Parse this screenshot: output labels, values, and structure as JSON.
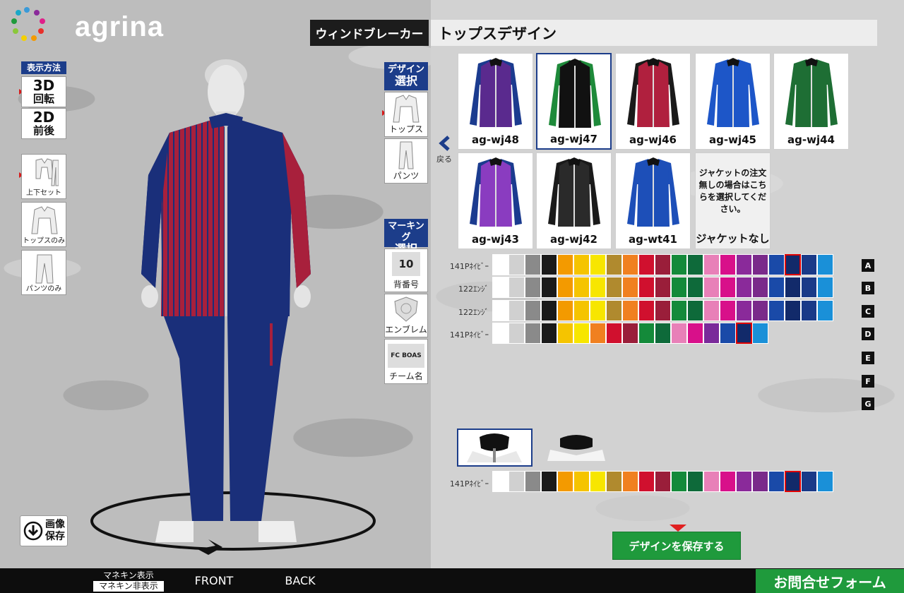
{
  "brand": {
    "name": "agrina"
  },
  "header": {
    "category": "ウィンドブレーカー",
    "title": "トップスデザイン"
  },
  "display_method": {
    "label": "表示方法",
    "options": [
      {
        "main": "3D",
        "sub": "回転"
      },
      {
        "main": "2D",
        "sub": "前後"
      }
    ]
  },
  "set_types": [
    {
      "label": "上下セット"
    },
    {
      "label": "トップスのみ"
    },
    {
      "label": "パンツのみ"
    }
  ],
  "design_menu": {
    "label_top": "デザイン",
    "label_bottom": "選択",
    "items": [
      {
        "label": "トップス"
      },
      {
        "label": "パンツ"
      }
    ]
  },
  "marking_menu": {
    "label_top": "マーキング",
    "label_bottom": "選択",
    "items": [
      {
        "label": "背番号",
        "thumb": "10"
      },
      {
        "label": "エンブレム"
      },
      {
        "label": "チーム名",
        "thumb": "FC BOAS"
      }
    ]
  },
  "back_label": "戻る",
  "products": [
    {
      "code": "ag-wj48",
      "body": "#5a2a8e",
      "sleeve": "#1b3b8f"
    },
    {
      "code": "ag-wj47",
      "body": "#111111",
      "sleeve": "#1e8a3a"
    },
    {
      "code": "ag-wj46",
      "body": "#b0203e",
      "sleeve": "#1a1a1a"
    },
    {
      "code": "ag-wj45",
      "body": "#1d56c8",
      "sleeve": "#1d56c8"
    },
    {
      "code": "ag-wj44",
      "body": "#1e6e34",
      "sleeve": "#1e6e34"
    },
    {
      "code": "ag-wj43",
      "body": "#8a3cc0",
      "sleeve": "#1b3b8f"
    },
    {
      "code": "ag-wj42",
      "body": "#2a2a2a",
      "sleeve": "#1a1a1a"
    },
    {
      "code": "ag-wt41",
      "body": "#1d4fb8",
      "sleeve": "#1d4fb8"
    }
  ],
  "no_jacket": {
    "note": "ジャケットの注文無しの場合はこちらを選択してください。",
    "label": "ジャケットなし"
  },
  "color_rows": [
    {
      "label": "141Pﾈｲﾋﾞｰ",
      "letter": "A"
    },
    {
      "label": "122ｴﾝｼﾞ",
      "letter": "B"
    },
    {
      "label": "122ｴﾝｼﾞ",
      "letter": "C"
    },
    {
      "label": "141Pﾈｲﾋﾞｰ",
      "letter": "D"
    }
  ],
  "extra_letters": [
    "E",
    "F",
    "G"
  ],
  "palette_full": [
    "#ffffff",
    "#d0d0d0",
    "#8a8a8a",
    "#1a1a1a",
    "#f39a00",
    "#f5c400",
    "#f7e600",
    "#b08a2e",
    "#f08020",
    "#d0102e",
    "#9a1e3a",
    "#148a3a",
    "#0e6a3a",
    "#e880b8",
    "#d8108a",
    "#8a2a9a",
    "#7a2a8a",
    "#1a4aa8",
    "#122a6a",
    "#1a3a88",
    "#1a90d8"
  ],
  "palette_short": [
    "#ffffff",
    "#d0d0d0",
    "#8a8a8a",
    "#1a1a1a",
    "#f5c400",
    "#f7e600",
    "#f08020",
    "#d0102e",
    "#9a1e3a",
    "#148a3a",
    "#0e6a3a",
    "#e880b8",
    "#d8108a",
    "#7a2a9a",
    "#1a4aa8",
    "#122a6a",
    "#1a90d8"
  ],
  "collar_row": {
    "label": "141Pﾈｲﾋﾞｰ"
  },
  "save_design": "デザインを保存する",
  "download": {
    "line1": "画像",
    "line2": "保存"
  },
  "footer": {
    "mannequin_on": "マネキン表示",
    "mannequin_off": "マネキン非表示",
    "front": "FRONT",
    "back": "BACK",
    "contact": "お問合せフォーム"
  },
  "colors": {
    "navy": "#1c3d8a",
    "green": "#1f9a3c",
    "jacket_red": "#a8203c",
    "jacket_navy": "#1a2f7a"
  }
}
